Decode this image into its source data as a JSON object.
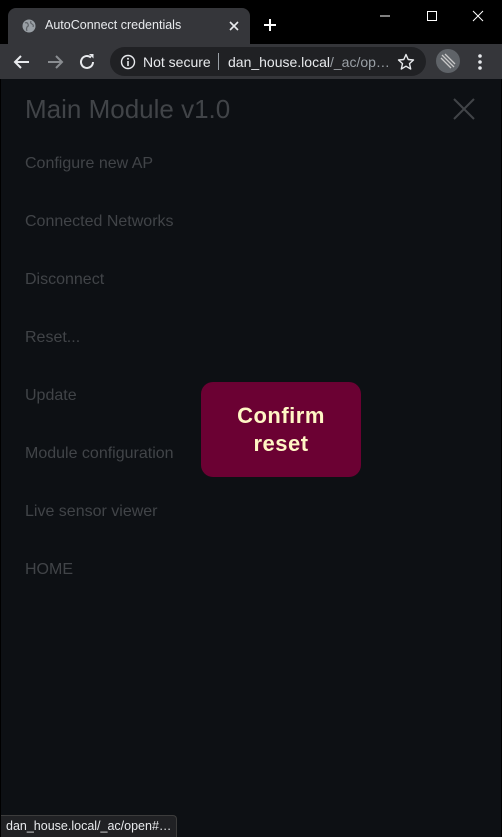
{
  "browser": {
    "tab_title": "AutoConnect credentials",
    "security_label": "Not secure",
    "url_host": "dan_house.local",
    "url_path": "/_ac/op…",
    "status_url": "dan_house.local/_ac/open#…"
  },
  "page": {
    "title": "Main Module v1.0",
    "menu_items": [
      "Configure new AP",
      "Connected Networks",
      "Disconnect",
      "Reset...",
      "Update",
      "Module configuration",
      "Live sensor viewer",
      "HOME"
    ],
    "confirm_reset_label": "Confirm reset"
  },
  "colors": {
    "page_background": "#0d1014",
    "menu_text": "#414448",
    "button_background": "#6b0133",
    "button_text": "#fff6c5"
  },
  "icons": [
    "globe-icon",
    "close-icon",
    "plus-icon",
    "minimize-icon",
    "maximize-icon",
    "back-icon",
    "forward-icon",
    "reload-icon",
    "info-icon",
    "star-icon",
    "extension-icon",
    "more-icon"
  ]
}
